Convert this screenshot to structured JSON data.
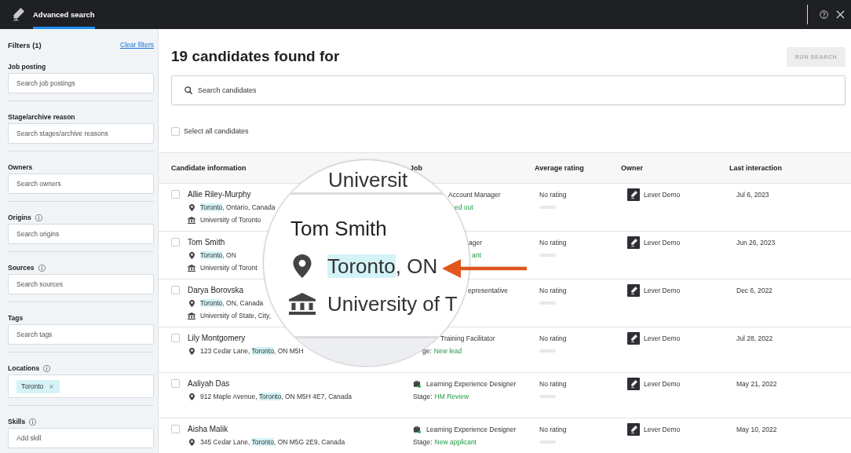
{
  "top_bar": {
    "tabs": [
      {
        "label": "Advanced search",
        "selected": true
      }
    ]
  },
  "filters": {
    "title": "Filters (1)",
    "clear_link": "Clear filters",
    "sections": [
      {
        "label": "Job posting",
        "info": false,
        "placeholder": "Search job postings"
      },
      {
        "label": "Stage/archive reason",
        "info": false,
        "placeholder": "Search stages/archive reasons"
      },
      {
        "label": "Owners",
        "info": false,
        "placeholder": "Search owners"
      },
      {
        "label": "Origins",
        "info": true,
        "placeholder": "Search origins"
      },
      {
        "label": "Sources",
        "info": true,
        "placeholder": "Search sources"
      },
      {
        "label": "Tags",
        "info": false,
        "placeholder": "Search tags"
      },
      {
        "label": "Locations",
        "info": true,
        "chips": [
          "Toronto"
        ]
      },
      {
        "label": "Skills",
        "info": true,
        "placeholder": "Add skill"
      }
    ]
  },
  "results": {
    "title": "19 candidates found for",
    "run_search": {
      "label": "RUN SEARCH",
      "disabled": true
    },
    "search": {
      "placeholder": "Search candidates"
    },
    "select_all": {
      "label": "Select all candidates",
      "checked": false
    }
  },
  "table": {
    "columns": [
      "Candidate information",
      "Job",
      "Average rating",
      "Owner",
      "Last interaction"
    ],
    "rows": [
      {
        "name": "Allie Riley-Murphy",
        "checked": false,
        "location": {
          "highlight": "Toronto",
          "after": ", Ontario, Canada"
        },
        "school": "University of Toronto",
        "job": {
          "kind": "cut",
          "title": "Account Manager",
          "stage": "ed out"
        },
        "rating": "No rating",
        "owner": "Lever Demo",
        "last_interaction": "Jul 6, 2023"
      },
      {
        "name": "Tom Smith",
        "checked": false,
        "location": {
          "highlight": "Toronto",
          "after": ", ON"
        },
        "school": "University of Toront",
        "job": {
          "kind": "cut",
          "title": "ager",
          "stage": "ant"
        },
        "rating": "No rating",
        "owner": "Lever Demo",
        "last_interaction": "Jun 26, 2023"
      },
      {
        "name": "Darya Borovska",
        "checked": false,
        "location": {
          "highlight": "Toronto",
          "after": ", ON, Canada"
        },
        "school": "University of State, City,",
        "job": {
          "kind": "cut",
          "title": "epresentative"
        },
        "rating": "No rating",
        "owner": "Lever Demo",
        "last_interaction": "Dec 6, 2022"
      },
      {
        "name": "Lily Montgomery",
        "checked": false,
        "location": {
          "before": "123 Cedar Lane, ",
          "highlight": "Toronto",
          "after": ", ON M5H"
        },
        "job": {
          "kind": "cut",
          "title": "Training Facilitator",
          "stage_label": "ge:",
          "stage": "New lead"
        },
        "rating": "No rating",
        "owner": "Lever Demo",
        "last_interaction": "Jul 28, 2022"
      },
      {
        "name": "Aaliyah Das",
        "checked": false,
        "location": {
          "before": "912 Maple Avenue, ",
          "highlight": "Toronto",
          "after": ", ON M5H 4E7, Canada"
        },
        "job": {
          "kind": "full",
          "title": "Learning Experience Designer",
          "stage_label": "Stage:",
          "stage": "HM Review"
        },
        "rating": "No rating",
        "owner": "Lever Demo",
        "last_interaction": "May 21, 2022"
      },
      {
        "name": "Aisha Malik",
        "checked": false,
        "location": {
          "before": "345 Cedar Lane, ",
          "highlight": "Toronto",
          "after": ", ON M5G 2E9, Canada"
        },
        "job": {
          "kind": "full",
          "title": "Learning Experience Designer",
          "stage_label": "Stage:",
          "stage": "New applicant"
        },
        "rating": "No rating",
        "owner": "Lever Demo",
        "last_interaction": "May 10, 2022"
      }
    ]
  },
  "magnifier": {
    "fragment": "Universit",
    "name": "Tom Smith",
    "location": {
      "highlight": "Toronto",
      "after": ", ON"
    },
    "school": "University of T"
  }
}
